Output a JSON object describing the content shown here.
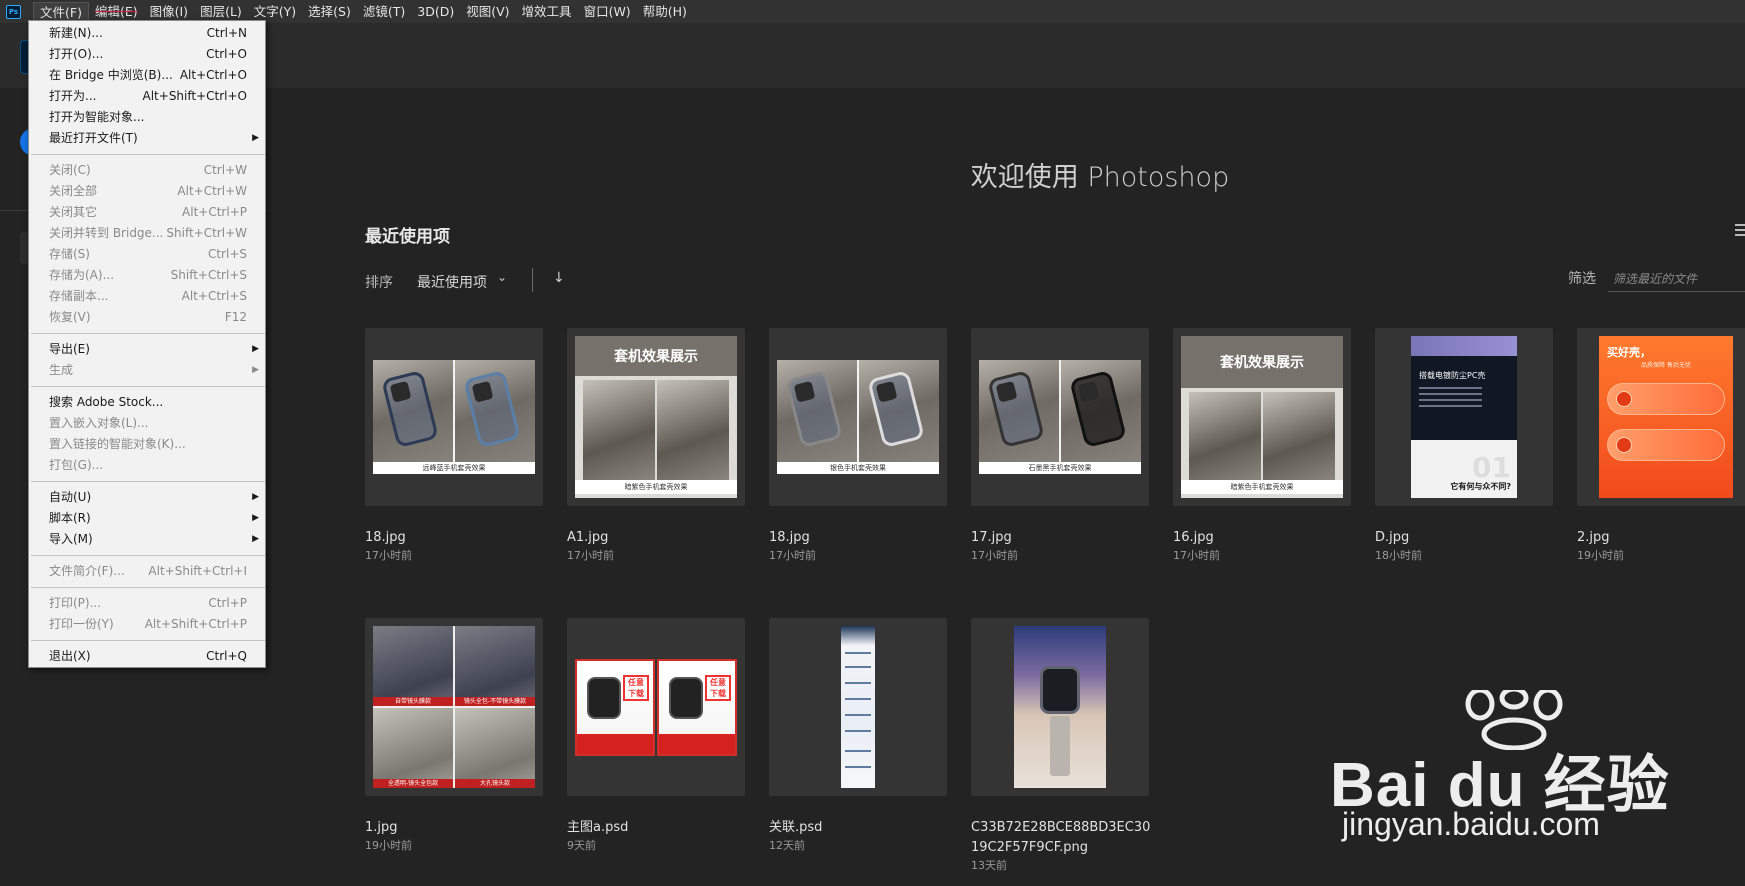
{
  "menubar": {
    "items": [
      "文件(F)",
      "编辑(E)",
      "图像(I)",
      "图层(L)",
      "文字(Y)",
      "选择(S)",
      "滤镜(T)",
      "3D(D)",
      "视图(V)",
      "增效工具",
      "窗口(W)",
      "帮助(H)"
    ],
    "logo": "Ps"
  },
  "file_menu": {
    "items": [
      {
        "label": "新建(N)...",
        "shortcut": "Ctrl+N"
      },
      {
        "label": "打开(O)...",
        "shortcut": "Ctrl+O"
      },
      {
        "label": "在 Bridge 中浏览(B)...",
        "shortcut": "Alt+Ctrl+O"
      },
      {
        "label": "打开为...",
        "shortcut": "Alt+Shift+Ctrl+O"
      },
      {
        "label": "打开为智能对象...",
        "shortcut": ""
      },
      {
        "label": "最近打开文件(T)",
        "shortcut": ""
      },
      {
        "label": "关闭(C)",
        "shortcut": "Ctrl+W"
      },
      {
        "label": "关闭全部",
        "shortcut": "Alt+Ctrl+W"
      },
      {
        "label": "关闭其它",
        "shortcut": "Alt+Ctrl+P"
      },
      {
        "label": "关闭并转到 Bridge...",
        "shortcut": "Shift+Ctrl+W"
      },
      {
        "label": "存储(S)",
        "shortcut": "Ctrl+S"
      },
      {
        "label": "存储为(A)...",
        "shortcut": "Shift+Ctrl+S"
      },
      {
        "label": "存储副本...",
        "shortcut": "Alt+Ctrl+S"
      },
      {
        "label": "恢复(V)",
        "shortcut": "F12"
      },
      {
        "label": "导出(E)",
        "shortcut": ""
      },
      {
        "label": "生成",
        "shortcut": ""
      },
      {
        "label": "搜索 Adobe Stock...",
        "shortcut": ""
      },
      {
        "label": "置入嵌入对象(L)...",
        "shortcut": ""
      },
      {
        "label": "置入链接的智能对象(K)...",
        "shortcut": ""
      },
      {
        "label": "打包(G)...",
        "shortcut": ""
      },
      {
        "label": "自动(U)",
        "shortcut": ""
      },
      {
        "label": "脚本(R)",
        "shortcut": ""
      },
      {
        "label": "导入(M)",
        "shortcut": ""
      },
      {
        "label": "文件简介(F)...",
        "shortcut": "Alt+Shift+Ctrl+I"
      },
      {
        "label": "打印(P)...",
        "shortcut": "Ctrl+P"
      },
      {
        "label": "打印一份(Y)",
        "shortcut": "Alt+Shift+Ctrl+P"
      },
      {
        "label": "退出(X)",
        "shortcut": "Ctrl+Q"
      }
    ]
  },
  "home": {
    "welcome": "欢迎使用 Photoshop",
    "recent_title": "最近使用项",
    "sort_label": "排序",
    "sort_value": "最近使用项",
    "sort_direction": "↓",
    "filter_label": "筛选",
    "filter_placeholder": "筛选最近的文件"
  },
  "thumb_text": {
    "a1_header": "套机效果展示",
    "b16_header": "套机效果展示",
    "d_title": "搭载电镀防尘PC壳",
    "d_bottom": "它有何与众不同?",
    "d_number": "01",
    "orange_title": "买好壳，",
    "orange_sub": "品质保障 售后无忧",
    "cap_18a": "远峰蓝手机套壳效果",
    "cap_a1": "暗紫色手机套壳效果",
    "cap_18b": "银色手机套壳效果",
    "cap_17": "石墨黑手机套壳效果",
    "cap_16": "暗紫色手机套壳效果",
    "quad_caps": [
      "自带镜头膜款",
      "镜头全包-不带镜头膜款",
      "全透明-镜头全包款",
      "大孔镜头款"
    ],
    "watch_badge": "任意下载"
  },
  "recent_files": [
    {
      "name": "18.jpg",
      "time": "17小时前"
    },
    {
      "name": "A1.jpg",
      "time": "17小时前"
    },
    {
      "name": "18.jpg",
      "time": "17小时前"
    },
    {
      "name": "17.jpg",
      "time": "17小时前"
    },
    {
      "name": "16.jpg",
      "time": "17小时前"
    },
    {
      "name": "D.jpg",
      "time": "18小时前"
    },
    {
      "name": "2.jpg",
      "time": "19小时前"
    },
    {
      "name": "1.jpg",
      "time": "19小时前"
    },
    {
      "name": "主图a.psd",
      "time": "9天前"
    },
    {
      "name": "关联.psd",
      "time": "12天前"
    },
    {
      "name": "C33B72E28BCE88BD3EC3019C2F57F9CF.png",
      "time": "13天前"
    }
  ],
  "watermark": {
    "brand": "Bai du 经验",
    "url": "jingyan.baidu.com"
  }
}
